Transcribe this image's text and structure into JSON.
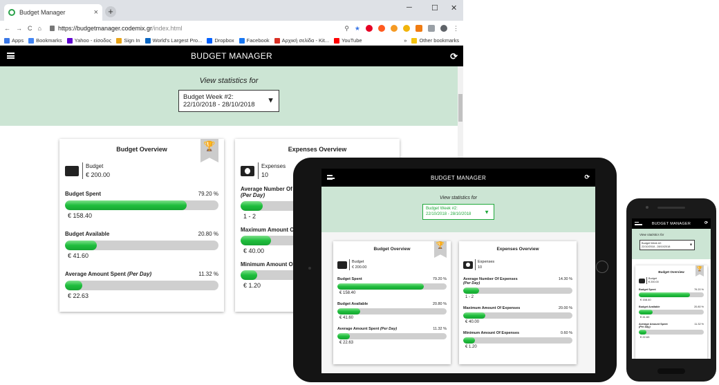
{
  "browser": {
    "tab_title": "Budget Manager",
    "tab_close": "×",
    "new_tab": "+",
    "minimize": "─",
    "maximize": "☐",
    "close": "✕",
    "url_host": "https://budgetmanager.codemix.gr",
    "url_path": "/index.html",
    "bookmarks": [
      {
        "label": "Apps",
        "color": "#3b78e7"
      },
      {
        "label": "Bookmarks",
        "color": "#4285f4"
      },
      {
        "label": "Yahoo - είσοδος",
        "color": "#5f01d1"
      },
      {
        "label": "Sign In",
        "color": "#e8a317"
      },
      {
        "label": "World's Largest Pro...",
        "color": "#0a66c2"
      },
      {
        "label": "Dropbox",
        "color": "#0061ff"
      },
      {
        "label": "Facebook",
        "color": "#1877f2"
      },
      {
        "label": "Αρχική σελίδα - Kit...",
        "color": "#d93025"
      },
      {
        "label": "YouTube",
        "color": "#ff0000"
      }
    ],
    "bookmarks_more": "»",
    "other_bookmarks": "Other bookmarks"
  },
  "app": {
    "title": "BUDGET MANAGER",
    "refresh_icon": "⟳",
    "view_stats_label": "View statistics for",
    "selected_period_line1": "Budget Week #2:",
    "selected_period_line2": "22/10/2018 - 28/10/2018",
    "dropdown_arrow": "▼",
    "budget_overview": {
      "title": "Budget Overview",
      "budget_label": "Budget",
      "budget_value": "€ 200.00",
      "trophy_icon": "🏆",
      "metrics": [
        {
          "label": "Budget Spent",
          "suffix": "",
          "percent_text": "79.20 %",
          "percent": 79.2,
          "value": "€ 158.40"
        },
        {
          "label": "Budget Available",
          "suffix": "",
          "percent_text": "20.80 %",
          "percent": 20.8,
          "value": "€ 41.60"
        },
        {
          "label": "Average Amount Spent",
          "suffix": "(Per Day)",
          "percent_text": "11.32 %",
          "percent": 11.32,
          "value": "€ 22.63"
        }
      ]
    },
    "expenses_overview": {
      "title": "Expenses Overview",
      "expenses_label": "Expenses",
      "expenses_value": "10",
      "metrics": [
        {
          "label": "Average Number Of Expenses",
          "suffix": "(Per Day)",
          "percent_text": "14.30 %",
          "percent": 14.3,
          "value": "1 - 2"
        },
        {
          "label": "Maximum Amount Of Expenses",
          "suffix": "",
          "percent_text": "20.00 %",
          "percent": 20.0,
          "value": "€ 40.00"
        },
        {
          "label": "Minimum Amount Of Expenses",
          "suffix": "",
          "percent_text": "0.60 %",
          "percent": 0.6,
          "value": "€ 1.20"
        }
      ]
    }
  },
  "desktop_clip": {
    "expenses_metric_labels": [
      "Average Number Of",
      "Maximum Amount O",
      "Minimum Amount O"
    ]
  }
}
